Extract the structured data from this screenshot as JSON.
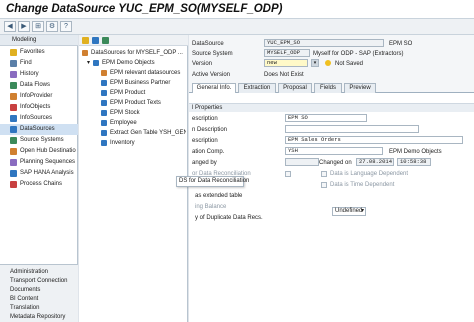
{
  "window": {
    "title": "Change DataSource YUC_EPM_SO(MYSELF_ODP)"
  },
  "nav": {
    "header": "Modeling",
    "items": [
      {
        "label": "Favorites",
        "icon": "star-icon",
        "color": "#e0b020"
      },
      {
        "label": "Find",
        "icon": "find-icon",
        "color": "#5a7fa8"
      },
      {
        "label": "History",
        "icon": "history-icon",
        "color": "#8a6cc0"
      },
      {
        "label": "Data Flows",
        "icon": "data-flow-icon",
        "color": "#3b8a5a"
      },
      {
        "label": "InfoProvider",
        "icon": "infoprovider-icon",
        "color": "#d08030"
      },
      {
        "label": "InfoObjects",
        "icon": "infoobject-icon",
        "color": "#c84040"
      },
      {
        "label": "InfoSources",
        "icon": "infosource-icon",
        "color": "#2f76c0"
      },
      {
        "label": "DataSources",
        "icon": "datasource-icon",
        "color": "#2f76c0"
      },
      {
        "label": "Source Systems",
        "icon": "source-system-icon",
        "color": "#3b8a5a"
      },
      {
        "label": "Open Hub Destinatio",
        "icon": "open-hub-icon",
        "color": "#d08030"
      },
      {
        "label": "Planning Sequences",
        "icon": "planning-icon",
        "color": "#8a6cc0"
      },
      {
        "label": "SAP HANA Analysis",
        "icon": "hana-icon",
        "color": "#2f76c0"
      },
      {
        "label": "Process Chains",
        "icon": "process-chain-icon",
        "color": "#c84040"
      }
    ],
    "selected_index": 7,
    "bottom_items": [
      "Administration",
      "Transport Connection",
      "Documents",
      "BI Content",
      "Translation",
      "Metadata Repository"
    ]
  },
  "tree": {
    "root_label": "DataSources for MYSELF_ODP ...",
    "node": "EPM Demo Objects",
    "children": [
      "EPM relevant datasources",
      "EPM Business Partner",
      "EPM Product",
      "EPM Product Texts",
      "EPM Stock",
      "Employee",
      "Extract Gen Table YSH_GEN",
      "Inventory"
    ]
  },
  "form": {
    "datasource_label": "DataSource",
    "datasource_value": "YUC_EPM_SO",
    "datasource_desc": "EPM SO",
    "source_system_label": "Source System",
    "source_system_value": "MYSELF_ODP",
    "source_system_desc": "Myself for ODP - SAP (Extractors)",
    "version_label": "Version",
    "version_value": "new",
    "version_status": "Not Saved",
    "active_version_label": "Active Version",
    "active_version_value": "Does Not Exist",
    "tabs": [
      "General Info.",
      "Extraction",
      "Proposal",
      "Fields",
      "Preview"
    ],
    "active_tab": 0,
    "properties_header": "l Properties",
    "short_desc_label": "escription",
    "short_desc_value": "EPM SO",
    "medium_desc_label": "n Description",
    "long_desc_label": "escription",
    "long_desc_value": "EPM Sales Orders",
    "app_comp_label": "ation Comp.",
    "app_comp_value": "YSH",
    "app_comp_desc": "EPM Demo Objects",
    "changed_by_label": "anged by",
    "changed_on_label": "Changed on",
    "changed_on_date": "27.08.2014",
    "changed_on_time": "10:58:38",
    "reconciliation_label": "or Data Reconciliation",
    "tooltip": "DS for Data Reconciliation",
    "lang_dependent": "Data is Language Dependent",
    "time_dependent": "Data is Time Dependent",
    "extended_table": "as extended table",
    "ing_balance": "ing Balance",
    "duplicate_label": "y of Duplicate Data Recs.",
    "duplicate_value": "Undefined"
  },
  "colors": {
    "accent": "#2f76c0",
    "selection": "#cfe0f2",
    "yellow_field": "#fff9c8",
    "tab_active": "#ffffff"
  }
}
